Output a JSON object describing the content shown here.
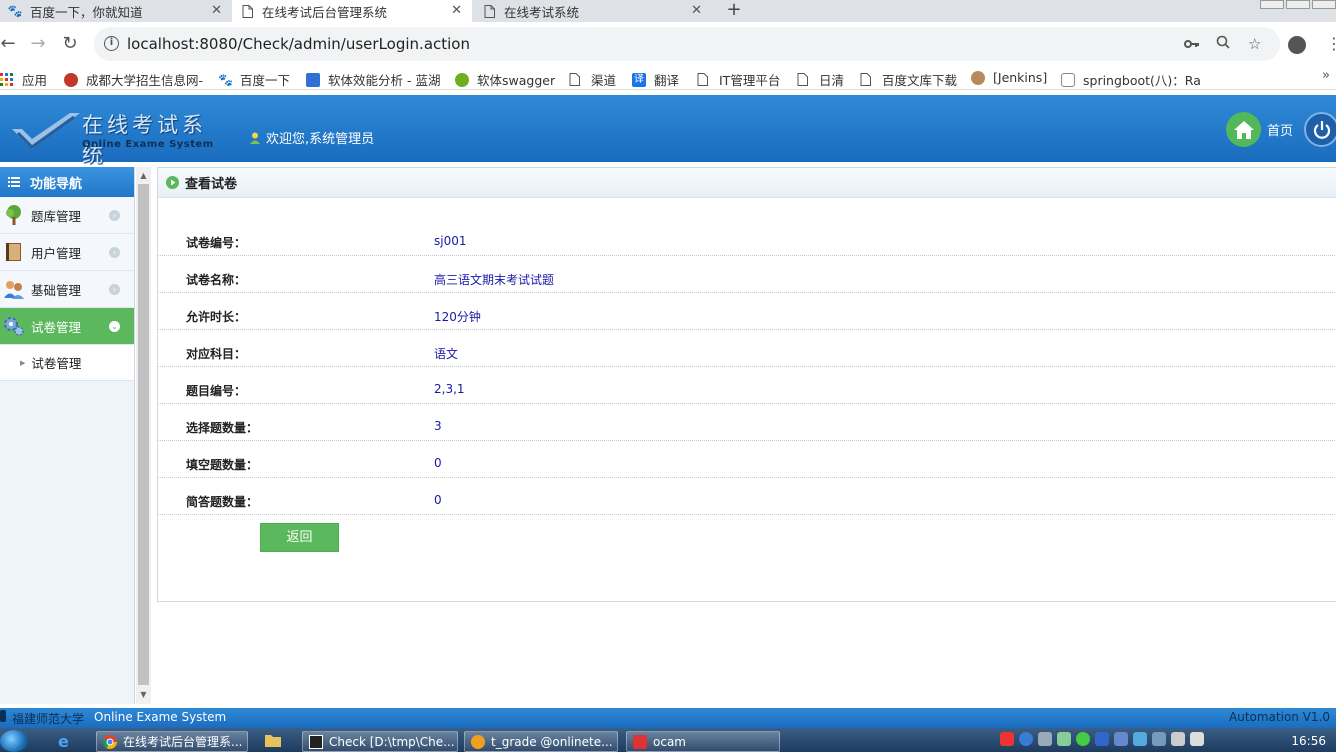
{
  "browser": {
    "tabs": [
      {
        "title": "百度一下，你就知道",
        "active": false
      },
      {
        "title": "在线考试后台管理系统",
        "active": true
      },
      {
        "title": "在线考试系统",
        "active": false
      }
    ],
    "url": "localhost:8080/Check/admin/userLogin.action",
    "bookmarks": [
      "应用",
      "成都大学招生信息网-",
      "百度一下",
      "软体效能分析 - 蓝湖",
      "软体swagger",
      "渠道",
      "翻译",
      "IT管理平台",
      "日清",
      "百度文库下载",
      "[Jenkins]",
      "springboot(八)：Ra"
    ]
  },
  "header": {
    "logo_title": "在线考试系统",
    "logo_subtitle": "Online Exame System",
    "welcome": "欢迎您,系统管理员",
    "home_label": "首页"
  },
  "sidebar": {
    "title": "功能导航",
    "items": [
      {
        "label": "题库管理",
        "active": false
      },
      {
        "label": "用户管理",
        "active": false
      },
      {
        "label": "基础管理",
        "active": false
      },
      {
        "label": "试卷管理",
        "active": true
      }
    ],
    "sub_items": [
      "试卷管理"
    ]
  },
  "panel": {
    "title": "查看试卷",
    "rows": [
      {
        "label": "试卷编号：",
        "value": "sj001"
      },
      {
        "label": "试卷名称：",
        "value": "高三语文期末考试试题"
      },
      {
        "label": "允许时长：",
        "value": "120分钟"
      },
      {
        "label": "对应科目：",
        "value": "语文"
      },
      {
        "label": "题目编号：",
        "value": "2,3,1"
      },
      {
        "label": "选择题数量：",
        "value": "3"
      },
      {
        "label": "填空题数量：",
        "value": "0"
      },
      {
        "label": "简答题数量：",
        "value": "0"
      }
    ],
    "back_label": "返回"
  },
  "footer": {
    "school": "福建师范大学",
    "system": "Online Exame System",
    "version": "Automation V1.0"
  },
  "taskbar": {
    "tasks": [
      "在线考试后台管理系...",
      "Check [D:\\tmp\\Che...",
      "t_grade @onlinete...",
      "ocam"
    ],
    "clock": "16:56"
  },
  "colors": {
    "header_blue": "#1a6cbf",
    "active_green": "#5cb85c",
    "value_blue": "#1a1aa8"
  }
}
